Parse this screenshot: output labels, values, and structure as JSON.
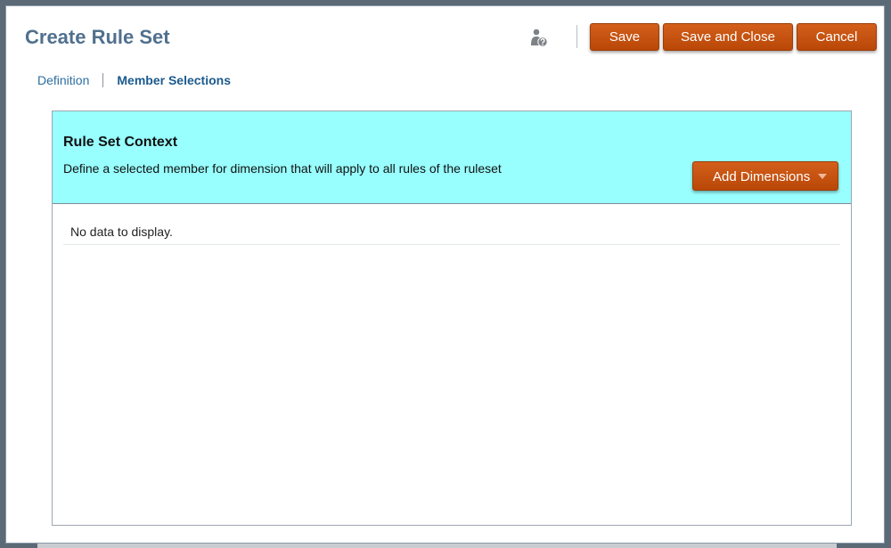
{
  "dialog": {
    "title": "Create Rule Set",
    "toolbar": {
      "help_icon": "user-help-icon",
      "save_label": "Save",
      "save_close_label": "Save and Close",
      "cancel_label": "Cancel"
    }
  },
  "tabs": [
    {
      "label": "Definition",
      "active": false
    },
    {
      "label": "Member Selections",
      "active": true
    }
  ],
  "context": {
    "title": "Rule Set Context",
    "description": "Define a selected member for dimension that will apply to all rules of the ruleset",
    "add_dimensions_label": "Add Dimensions",
    "dropdown_icon": "chevron-down-icon"
  },
  "table": {
    "empty_message": "No data to display."
  },
  "colors": {
    "accent_button": "#c24f0e",
    "context_bg": "#98fefe",
    "title": "#51708e",
    "tab_link": "#2d6ea1"
  }
}
